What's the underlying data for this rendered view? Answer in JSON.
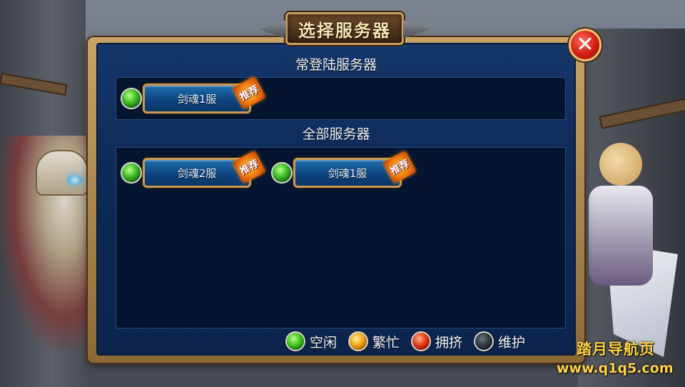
{
  "window": {
    "title": "选择服务器"
  },
  "sections": {
    "frequent_title": "常登陆服务器",
    "all_title": "全部服务器"
  },
  "frequent_servers": [
    {
      "name": "剑魂1服",
      "status": "idle",
      "tag": "推荐"
    }
  ],
  "all_servers": [
    {
      "name": "剑魂2服",
      "status": "idle",
      "tag": "推荐"
    },
    {
      "name": "剑魂1服",
      "status": "idle",
      "tag": "推荐"
    }
  ],
  "legend": [
    {
      "label": "空闲",
      "color": "#3ec21f"
    },
    {
      "label": "繁忙",
      "color": "#f2a516"
    },
    {
      "label": "拥挤",
      "color": "#e43a12"
    },
    {
      "label": "维护",
      "color": "#2c333a"
    }
  ],
  "watermark": {
    "title": "踏月导航页",
    "url": "www.q1q5.com"
  },
  "icons": {
    "close": "close-icon",
    "status": "status-dot-icon"
  }
}
